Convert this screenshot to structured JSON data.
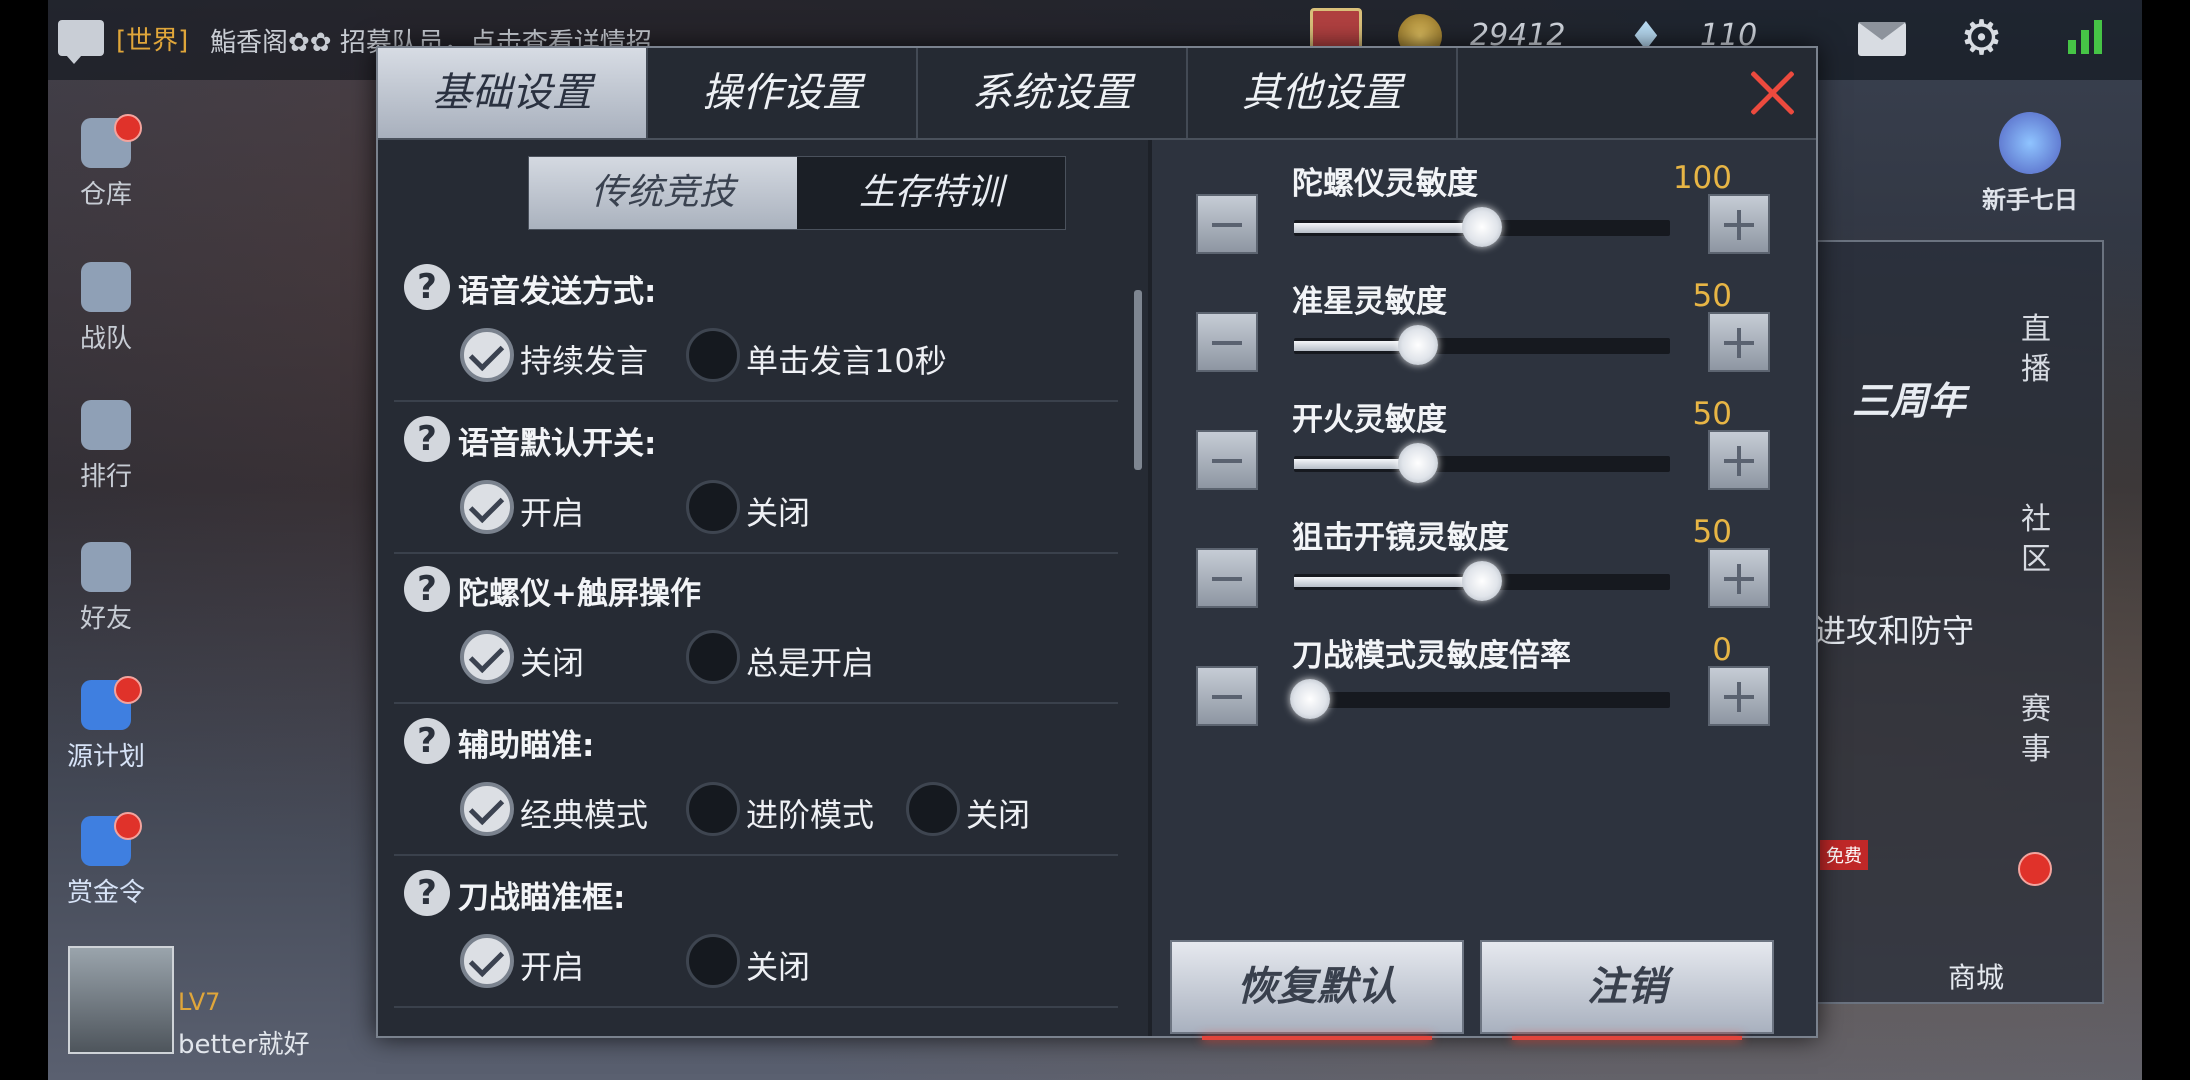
{
  "topbar": {
    "chat_channel": "[世界]",
    "chat_text": "鮨香阁✿✿ 招募队员，点击查看详情招",
    "coins": "29412",
    "gems": "110"
  },
  "sidebar": {
    "items": [
      {
        "label": "仓库",
        "badge": true
      },
      {
        "label": "战队",
        "badge": false
      },
      {
        "label": "排行",
        "badge": false
      },
      {
        "label": "好友",
        "badge": false
      },
      {
        "label": "源计划",
        "badge": true
      },
      {
        "label": "赏金令",
        "badge": true
      }
    ],
    "player_level": "LV7",
    "player_name": "better就好"
  },
  "right_rail": {
    "newbie": "新手七日",
    "tab_live": "直播",
    "tab_community": "社区",
    "tab_events": "赛事",
    "anniversary": "三周年",
    "attack_defense": "进攻和防守",
    "free": "免费",
    "shop": "商城"
  },
  "modal": {
    "tabs": [
      "基础设置",
      "操作设置",
      "系统设置",
      "其他设置"
    ],
    "active_tab": 0,
    "subtabs": [
      "传统竞技",
      "生存特训"
    ],
    "active_subtab": 0,
    "settings": [
      {
        "title": "语音发送方式:",
        "options": [
          "持续发言",
          "单击发言10秒"
        ],
        "selected": 0
      },
      {
        "title": "语音默认开关:",
        "options": [
          "开启",
          "关闭"
        ],
        "selected": 0
      },
      {
        "title": "陀螺仪+触屏操作",
        "options": [
          "关闭",
          "总是开启"
        ],
        "selected": 0
      },
      {
        "title": "辅助瞄准:",
        "options": [
          "经典模式",
          "进阶模式",
          "关闭"
        ],
        "selected": 0
      },
      {
        "title": "刀战瞄准框:",
        "options": [
          "开启",
          "关闭"
        ],
        "selected": 0
      }
    ],
    "sliders": [
      {
        "name": "陀螺仪灵敏度",
        "value": "100",
        "level": 0.5
      },
      {
        "name": "准星灵敏度",
        "value": "50",
        "level": 0.33
      },
      {
        "name": "开火灵敏度",
        "value": "50",
        "level": 0.33
      },
      {
        "name": "狙击开镜灵敏度",
        "value": "50",
        "level": 0.5
      },
      {
        "name": "刀战模式灵敏度倍率",
        "value": "0",
        "level": 0.0
      }
    ],
    "reset_label": "恢复默认",
    "logout_label": "注销"
  }
}
